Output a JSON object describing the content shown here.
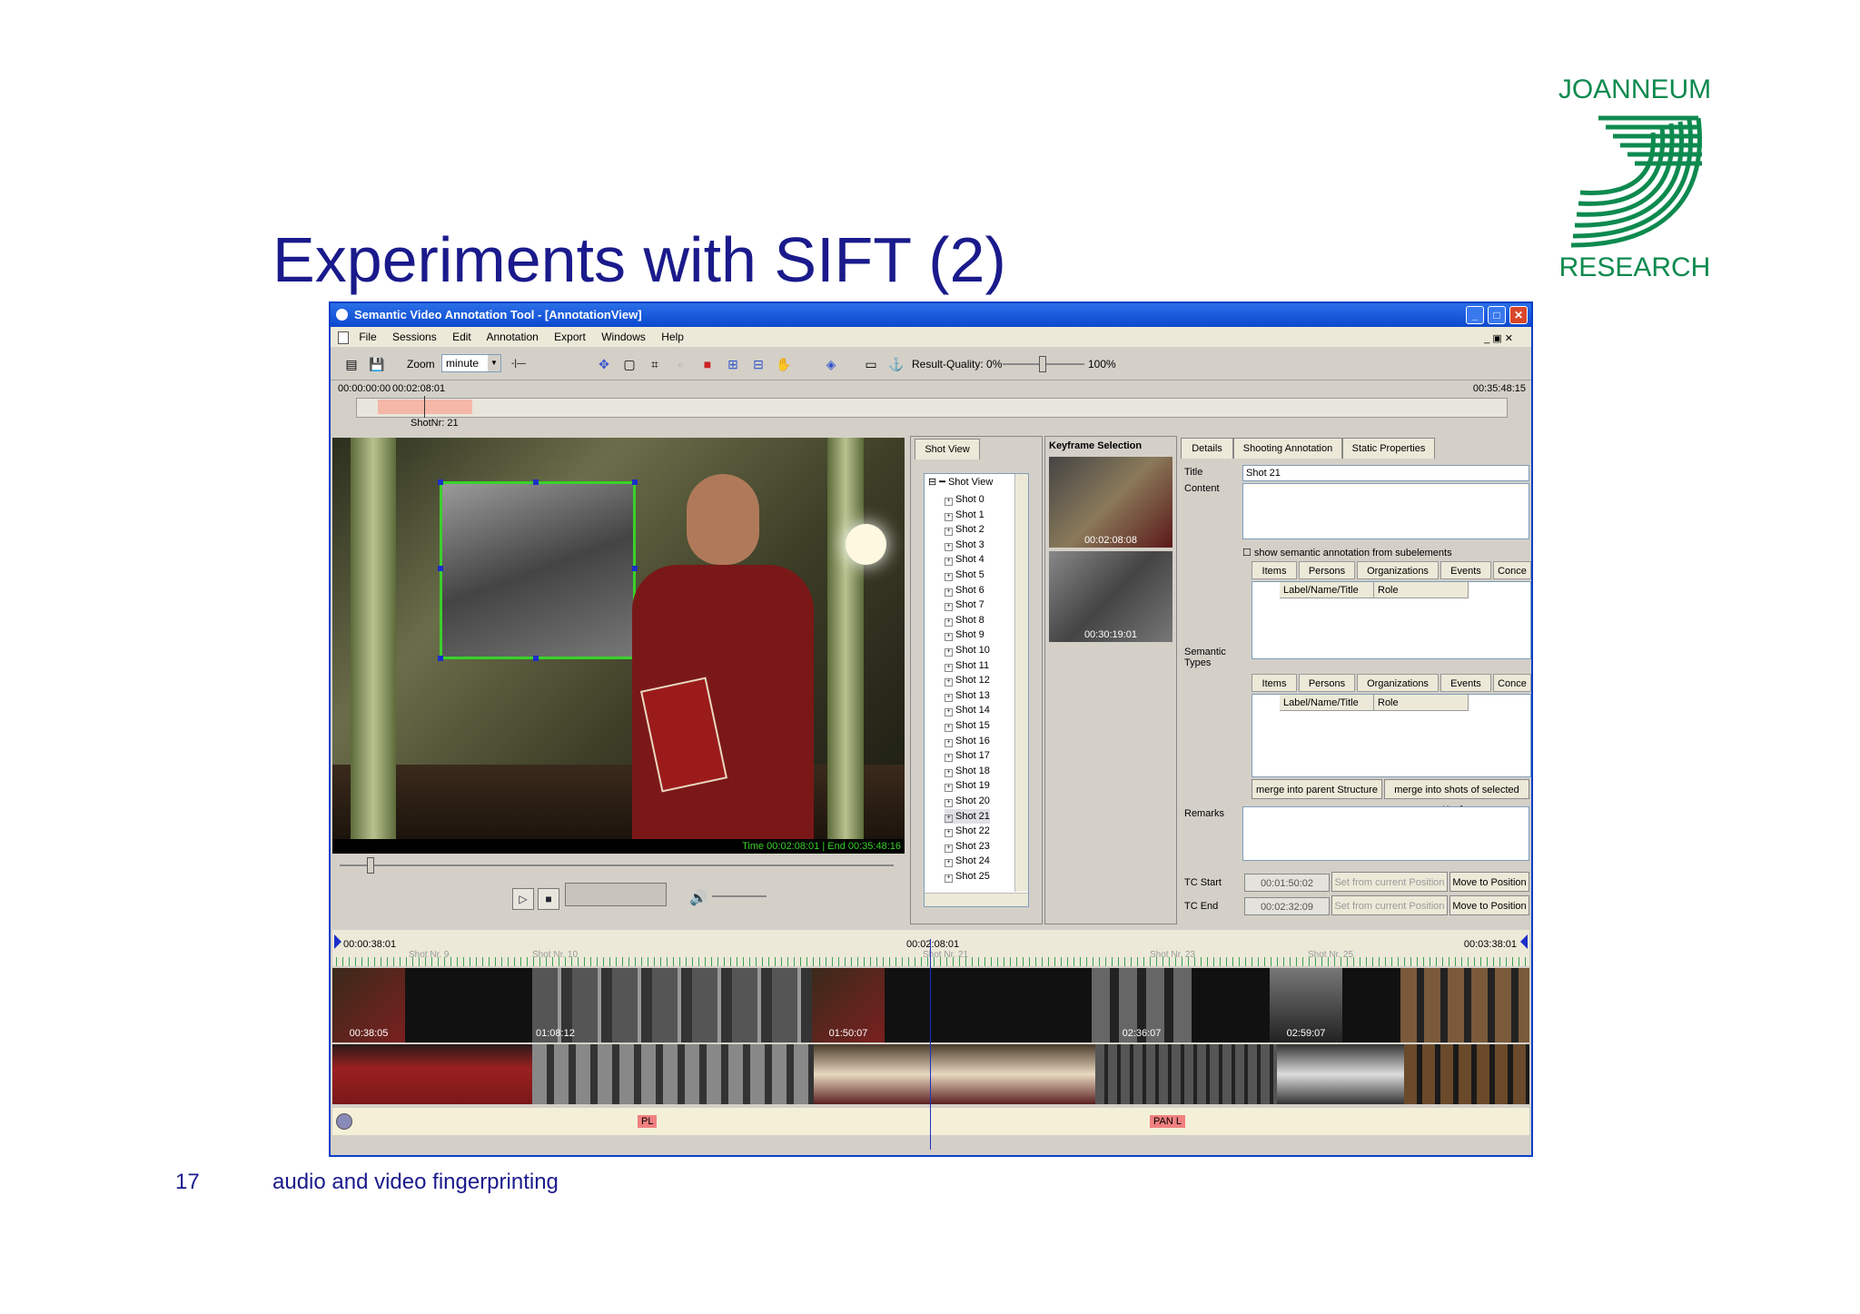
{
  "slide": {
    "title": "Experiments with SIFT (2)",
    "number": "17",
    "footer": "audio and video fingerprinting",
    "logo": {
      "line1": "JOANNEUM",
      "line2": "RESEARCH",
      "color": "#0e8a4f"
    }
  },
  "window": {
    "title": "Semantic Video Annotation Tool - [AnnotationView]",
    "menu": [
      "File",
      "Sessions",
      "Edit",
      "Annotation",
      "Export",
      "Windows",
      "Help"
    ],
    "toolbar": {
      "zoom_label": "Zoom",
      "zoom_value": "minute",
      "result_quality_label": "Result-Quality: 0%",
      "result_quality_max": "100%"
    },
    "top_timeline": {
      "start": "00:00:00:00",
      "current": "00:02:08:01",
      "end": "00:35:48:15",
      "shot_label": "ShotNr: 21"
    },
    "video": {
      "time_readout": "Time 00:02:08:01 | End 00:35:48:16"
    },
    "shot_view": {
      "tab": "Shot View",
      "root": "Shot View",
      "items": [
        "Shot 0",
        "Shot 1",
        "Shot 2",
        "Shot 3",
        "Shot 4",
        "Shot 5",
        "Shot 6",
        "Shot 7",
        "Shot 8",
        "Shot 9",
        "Shot 10",
        "Shot 11",
        "Shot 12",
        "Shot 13",
        "Shot 14",
        "Shot 15",
        "Shot 16",
        "Shot 17",
        "Shot 18",
        "Shot 19",
        "Shot 20",
        "Shot 21",
        "Shot 22",
        "Shot 23",
        "Shot 24",
        "Shot 25"
      ],
      "selected": "Shot 21"
    },
    "keyframes": {
      "title": "Keyframe Selection",
      "frames": [
        "00:02:08:08",
        "00:30:19:01"
      ]
    },
    "details": {
      "tabs": [
        "Details",
        "Shooting Annotation",
        "Static Properties"
      ],
      "title_label": "Title",
      "title_value": "Shot 21",
      "content_label": "Content",
      "checkbox_label": "show semantic annotation from subelements",
      "subtabs": [
        "Items",
        "Persons",
        "Organizations",
        "Events",
        "Conce"
      ],
      "grid_cols": [
        "Label/Name/Title",
        "Role"
      ],
      "semantic_types_label": "Semantic Types",
      "merge_parent": "merge into parent Structure",
      "merge_shots": "merge into shots of selected Keyfra",
      "remarks_label": "Remarks",
      "tc_start_label": "TC Start",
      "tc_start_value": "00:01:50:02",
      "tc_end_label": "TC End",
      "tc_end_value": "00:02:32:09",
      "set_from_current": "Set from current Position",
      "move_to_position": "Move to Position"
    },
    "bottom_timeline": {
      "start": "00:00:38:01",
      "current": "00:02:08:01",
      "end": "00:03:38:01",
      "shot_labels": [
        "Shot Nr. 9",
        "Shot Nr. 10",
        "Shot Nr. 21",
        "Shot Nr. 23",
        "Shot Nr. 25"
      ],
      "thumb_times": [
        "00:38:05",
        "01:08:12",
        "01:50:07",
        "02:36:07",
        "02:59:07"
      ],
      "tags": [
        "PL",
        "PAN L"
      ]
    }
  }
}
